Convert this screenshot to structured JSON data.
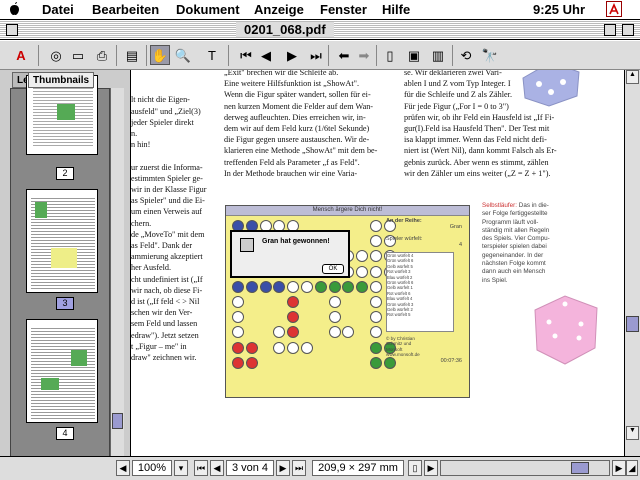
{
  "menubar": {
    "apple_label": "",
    "items": [
      "Datei",
      "Bearbeiten",
      "Dokument",
      "Anzeige",
      "Fenster",
      "Hilfe"
    ],
    "clock": "9:25 Uhr"
  },
  "window": {
    "title": "0201_068.pdf"
  },
  "sidebar": {
    "tab_left": "Le",
    "tab_active": "Thumbnails",
    "pages": [
      "2",
      "3",
      "4"
    ],
    "selected_page": "3"
  },
  "article": {
    "col1": "\n\nlt nicht die Eigen-\nausfeld\" und „Ziel(3)\njeder Spieler direkt\nn.\nn hin!\n\nur zuerst die Informa-\nestimmten Spieler ge-\nwir in der Klasse Figur\nas Spieler\" und die Ei-\num einen Verweis auf\nchern.\nde „MoveTo\" mit dem\nas Feld\". Dank der\nammierung akzeptiert\nher Ausfeld.\ncht undefiniert ist („If\nwir nach, ob diese Fi-\nd ist („If feld < > Nil\nschen wir den Ver-\nsem Feld und lassen\nedraw\"). Jetzt setzen\nt „Figur – me\" in\ndraw\" zeichnen wir.",
    "col2": "„Exit\" brechen wir die Schleife ab.\nEine weitere Hilfsfunktion ist „ShowAt\".\nWenn die Figur später wandert, sollen für ei-\nnen kurzen Moment die Felder auf dem Wan-\nderweg aufleuchten. Dies erreichen wir, in-\ndem wir auf dem Feld kurz (1/6tel Sekunde)\ndie Figur gegen unsere austauschen. Wir de-\nklarieren eine Methode „ShowAt\" mit dem be-\ntreffenden Feld als Parameter „f as Feld\".\nIn der Methode brauchen wir eine Varia-",
    "col3": "se. Wir deklarieren zwei Vari-\nablen I und Z vom Typ Integer. I\nfür die Schleife und Z als Zähler.\nFür jede Figur („For I = 0 to 3\")\nprüfen wir, ob ihr Feld ein Hausfeld ist „If Fi-\ngur(I).Feld isa Hausfeld Then\". Der Test mit\nisa klappt immer. Wenn das Feld nicht defi-\nniert ist (Wert Nil), dann kommt Falsch als Er-\ngebnis zurück. Aber wenn es stimmt, zählen\nwir den Zähler um eins weiter („Z = Z + 1\").",
    "note_heading": "Selbstläufer:",
    "note": " Das in die-\nser Folge fertiggestellte\nProgramm läuft voll-\nständig mit allen Regeln\ndes Spiels. Vier Compu-\nterspieler spielen dabei\ngegeneinander. In der\nnächsten Folge kommt\ndann auch ein Mensch\nins Spiel."
  },
  "game": {
    "window_title": "Mensch ärgere Dich nicht!",
    "dialog_text": "Gran hat gewonnen!",
    "dialog_ok": "OK",
    "panel_heading": "An der Reihe:",
    "panel_current": "Gran",
    "panel_label2": "Spieler würfelt:",
    "panel_val2": "4",
    "log": [
      "Grün würfelt 4",
      "Grün würfelt 6",
      "Gelb würfelt 5",
      "Rot würfelt 3",
      "Blau würfelt 2",
      "Grün würfelt 6",
      "Gelb würfelt 1",
      "Rot würfelt 6",
      "Blau würfelt 4",
      "Grün würfelt 3",
      "Gelb würfelt 2",
      "Rot würfelt 5"
    ],
    "credit": "© by Christian\nSchmitz und\nMonsoft\nwww.monsoft.de",
    "version": "00:0?:36"
  },
  "status": {
    "zoom": "100%",
    "page_of": "3 von 4",
    "page_size": "209,9 × 297 mm"
  },
  "colors": {
    "red": "#d33",
    "blue": "#3a4fa8",
    "green": "#3a9a3a",
    "yellow": "#f0e020",
    "die_blue": "#9aa6e0",
    "die_pink": "#f0a8d8",
    "note_red": "#c33"
  }
}
